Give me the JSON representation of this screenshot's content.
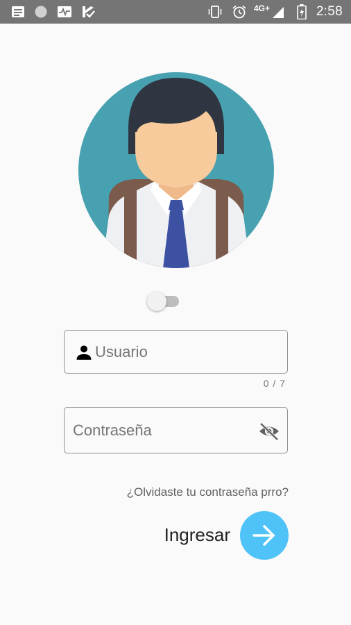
{
  "status_bar": {
    "time": "2:58",
    "network": "4G+",
    "icons": [
      "notification-icon",
      "circle-icon",
      "activity-icon",
      "check-flag-icon",
      "vibrate-icon",
      "alarm-icon",
      "signal-icon",
      "battery-icon"
    ]
  },
  "avatar": {
    "icon": "student-avatar-icon",
    "colors": {
      "background": "#48a1b0",
      "hair": "#2f3541",
      "skin": "#f7cb9c",
      "shirt": "#eef0f4",
      "tie": "#3d51a3",
      "straps": "#7a5b4c"
    }
  },
  "toggle": {
    "state": "off"
  },
  "username": {
    "placeholder": "Usuario",
    "value": "",
    "counter": "0 / 7",
    "icon": "person-icon"
  },
  "password": {
    "placeholder": "Contraseña",
    "value": "",
    "icon": "visibility-off-icon"
  },
  "forgot_link": "¿Olvidaste tu contraseña prro?",
  "login": {
    "label": "Ingresar",
    "button_icon": "arrow-right-icon",
    "accent": "#4fc3f7"
  }
}
